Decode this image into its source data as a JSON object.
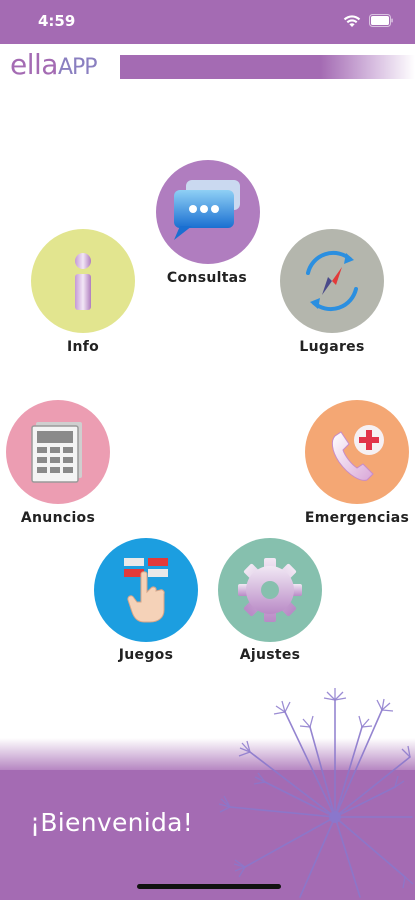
{
  "status_bar": {
    "time": "4:59"
  },
  "header": {
    "logo_ella": "ella",
    "logo_app": "APP"
  },
  "menu": {
    "consultas": {
      "label": "Consultas",
      "icon": "chat-bubbles-icon",
      "color": "#b07dbf"
    },
    "info": {
      "label": "Info",
      "icon": "info-icon",
      "color": "#e2e58f"
    },
    "lugares": {
      "label": "Lugares",
      "icon": "compass-icon",
      "color": "#b4b6ad"
    },
    "anuncios": {
      "label": "Anuncios",
      "icon": "newspaper-icon",
      "color": "#ec9db2"
    },
    "emergencias": {
      "label": "Emergencias",
      "icon": "phone-cross-icon",
      "color": "#f4a774"
    },
    "juegos": {
      "label": "Juegos",
      "icon": "hand-touch-icon",
      "color": "#1c9ee0"
    },
    "ajustes": {
      "label": "Ajustes",
      "icon": "gear-icon",
      "color": "#86c0ae"
    }
  },
  "footer": {
    "welcome": "¡Bienvenida!"
  },
  "colors": {
    "brand": "#a46bb3",
    "accent": "#8a7fc0"
  }
}
